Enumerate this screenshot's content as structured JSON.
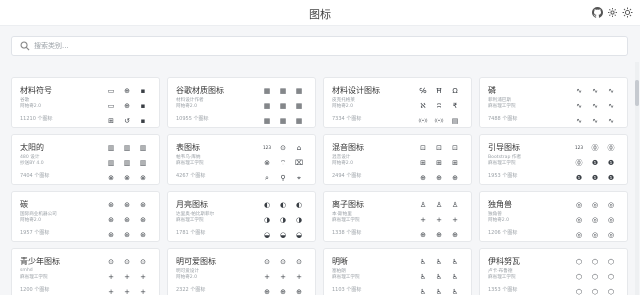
{
  "header": {
    "title": "图标",
    "controls": [
      "github-icon",
      "gear-icon",
      "sun-icon"
    ]
  },
  "search": {
    "placeholder": "搜索类别..."
  },
  "collections": [
    {
      "name": "材料符号",
      "author": "谷歌",
      "license": "阿帕奇2.0",
      "count": "11210 个图标",
      "icons": [
        "▭",
        "⊕",
        "▪",
        "▭",
        "⊕",
        "▪",
        "⊞",
        "↺",
        "▪"
      ]
    },
    {
      "name": "谷歌材质图标",
      "author": "材料设计作者",
      "license": "阿帕奇2.0",
      "count": "10955 个图标",
      "icons": [
        "▦",
        "▦",
        "▦",
        "▦",
        "▦",
        "▦",
        "▦",
        "▦",
        "▦"
      ]
    },
    {
      "name": "材料设计图标",
      "author": "皮克托格莱",
      "license": "阿帕奇2.0",
      "count": "7334 个图标",
      "icons": [
        "℅",
        "Ħ",
        "Ω",
        "ℵ",
        "ʭ",
        "₹",
        "((•))",
        "((•))",
        "▤"
      ]
    },
    {
      "name": "磷",
      "author": "菲利浦巴斯",
      "license": "麻省理工学院",
      "count": "7488 个图标",
      "icons": [
        "∿",
        "∿",
        "∿",
        "∿",
        "∿",
        "∿",
        "∿",
        "∿",
        "∿"
      ]
    },
    {
      "name": "太阳的",
      "author": "480 设计",
      "license": "抄送BY 4.0",
      "count": "7404 个图标",
      "icons": [
        "▥",
        "▥",
        "▥",
        "▥",
        "▥",
        "▥",
        "⊗",
        "⊗",
        "⊗"
      ]
    },
    {
      "name": "表图标",
      "author": "帕韦乌·库纳",
      "license": "麻省理工学院",
      "count": "4267 个图标",
      "icons": [
        "123",
        "⊙",
        "⌂",
        "⊗",
        "⌔",
        "⌧",
        "⌕",
        "⚲",
        "⌖"
      ]
    },
    {
      "name": "混音图标",
      "author": "混音设计",
      "license": "阿帕奇2.0",
      "count": "2494 个图标",
      "icons": [
        "⊡",
        "⊡",
        "⊡",
        "⊞",
        "⊞",
        "⊞",
        "⊕",
        "⊕",
        "⊕"
      ]
    },
    {
      "name": "引导图标",
      "author": "Bootstrap 作者",
      "license": "麻省理工学院",
      "count": "1953 个图标",
      "icons": [
        "123",
        "⓪",
        "⓪",
        "⓪",
        "❶",
        "❶",
        "❶",
        "❶",
        "❶"
      ]
    },
    {
      "name": "碳",
      "author": "国际商业机器公司",
      "license": "阿帕奇2.0",
      "count": "1957 个图标",
      "icons": [
        "⊛",
        "⊛",
        "⊛",
        "⊛",
        "⊛",
        "⊛",
        "⊛",
        "⊛",
        "⊛"
      ]
    },
    {
      "name": "月亮图标",
      "author": "达里奥·帕比斯菲尔",
      "license": "麻省理工学院",
      "count": "1781 个图标",
      "icons": [
        "◐",
        "◐",
        "◐",
        "◑",
        "◑",
        "◑",
        "◒",
        "◒",
        "◒"
      ]
    },
    {
      "name": "离子图标",
      "author": "本·斯帕里",
      "license": "麻省理工学院",
      "count": "1338 个图标",
      "icons": [
        "♙",
        "♙",
        "♙",
        "+",
        "+",
        "+",
        "⊕",
        "⊕",
        "⊕"
      ]
    },
    {
      "name": "独角兽",
      "author": "独角兽",
      "license": "阿帕奇2.0",
      "count": "1206 个图标",
      "icons": [
        "◎",
        "◎",
        "◎",
        "◎",
        "◎",
        "◎",
        "◎",
        "◎",
        "◎"
      ]
    },
    {
      "name": "青少年图标",
      "author": "smhd",
      "license": "麻省理工学院",
      "count": "1200 个图标",
      "icons": [
        "⊙",
        "⊙",
        "⊙",
        "+",
        "+",
        "+",
        "+",
        "+",
        "+"
      ]
    },
    {
      "name": "明可爱图标",
      "author": "明可爱设计",
      "license": "阿帕奇2.0",
      "count": "2322 个图标",
      "icons": [
        "⊙",
        "⊙",
        "⊙",
        "+",
        "+",
        "+",
        "⊕",
        "⊕",
        "⊕"
      ]
    },
    {
      "name": "明晰",
      "author": "塞柏朗",
      "license": "麻省理工学院",
      "count": "1103 个图标",
      "icons": [
        "♿",
        "♿",
        "♿",
        "♿",
        "♿",
        "♿",
        "♿",
        "♿",
        "♿"
      ]
    },
    {
      "name": "伊科努瓦",
      "author": "卢卡·布鲁德",
      "license": "麻省理工学院",
      "count": "1353 个图标",
      "icons": [
        "⬡",
        "⬡",
        "⬡",
        "⬡",
        "⬡",
        "⬡",
        "⬡",
        "⬡",
        "⬡"
      ]
    }
  ]
}
